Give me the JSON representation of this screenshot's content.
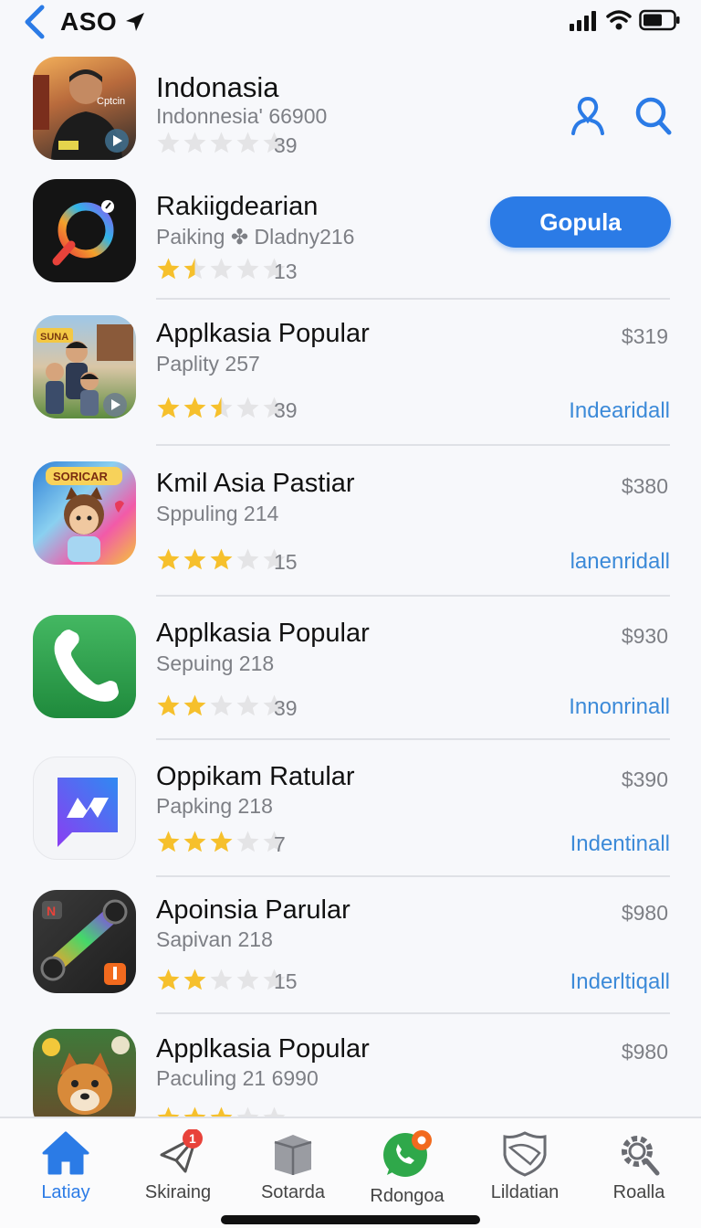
{
  "status_bar": {
    "carrier": "ASO"
  },
  "colors": {
    "accent": "#2b7be6",
    "link": "#3c8ad8",
    "star": "#f6c02c",
    "star_empty": "#e4e4e6"
  },
  "header_actions": {
    "profile_icon": "person-icon",
    "search_icon": "search-icon"
  },
  "apps": [
    {
      "title": "Indonasia",
      "subtitle": "Indonnesia' 66900",
      "rating": 0,
      "rating_count": "39",
      "price": "",
      "action": ""
    },
    {
      "title": "Rakiigdearian",
      "subtitle": "Paiking ✤ Dladny216",
      "rating": 1.5,
      "rating_count": "13",
      "price": "",
      "action": "Gopula"
    },
    {
      "title": "Applkasia Popular",
      "subtitle": "Paplity 257",
      "rating": 2.5,
      "rating_count": "39",
      "price": "$319",
      "action": "Indearidall"
    },
    {
      "title": "Kmil Asia Pastiar",
      "subtitle": "Sppuling 214",
      "rating": 3,
      "rating_count": "15",
      "price": "$380",
      "action": "lanenridall"
    },
    {
      "title": "Applkasia Popular",
      "subtitle": "Sepuing 218",
      "rating": 2,
      "rating_count": "39",
      "price": "$930",
      "action": "Innonrinall"
    },
    {
      "title": "Oppikam Ratular",
      "subtitle": "Papking 218",
      "rating": 3,
      "rating_count": "7",
      "price": "$390",
      "action": "Indentinall"
    },
    {
      "title": "Apoinsia Parular",
      "subtitle": "Sapivan 218",
      "rating": 2,
      "rating_count": "15",
      "price": "$980",
      "action": "Inderltiqall"
    },
    {
      "title": "Applkasia Popular",
      "subtitle": "Paculing 21 6990",
      "rating": 3,
      "rating_count": "",
      "price": "$980",
      "action": ""
    }
  ],
  "tabs": [
    {
      "label": "Latiay",
      "icon": "home-icon",
      "active": true
    },
    {
      "label": "Skiraing",
      "icon": "paper-plane-icon",
      "badge": "1"
    },
    {
      "label": "Sotarda",
      "icon": "box-icon"
    },
    {
      "label": "Rdongoa",
      "icon": "chat-bubble-icon"
    },
    {
      "label": "Lildatian",
      "icon": "shield-icon"
    },
    {
      "label": "Roalla",
      "icon": "gear-icon"
    }
  ]
}
